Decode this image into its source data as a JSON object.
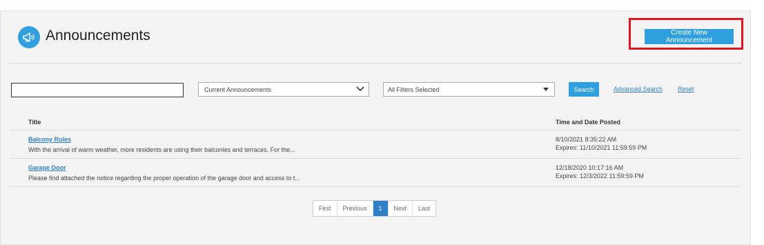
{
  "header": {
    "title": "Announcements",
    "icon": "megaphone-icon",
    "create_button": "Create New Announcement"
  },
  "search": {
    "keyword_value": "",
    "status_select": "Current Announcements",
    "filter_select": "All Filters Selected",
    "search_button": "Search",
    "advanced_search": "Advanced Search",
    "reset": "Reset"
  },
  "table": {
    "columns": [
      "Title",
      "Time and Date Posted"
    ],
    "rows": [
      {
        "title": "Balcony Rules",
        "description": "With the arrival of warm weather, more residents are using their balconies and terraces. For the...",
        "posted": "8/10/2021 8:35:22 AM",
        "expires": "Expires: 11/10/2021 11:59:59 PM"
      },
      {
        "title": "Garage Door",
        "description": "Please find attached the notice regarding the proper operation of the garage door and access to t...",
        "posted": "12/18/2020 10:17:16 AM",
        "expires": "Expires: 12/3/2022 11:59:59 PM"
      }
    ]
  },
  "pagination": {
    "first": "First",
    "previous": "Previous",
    "current": "1",
    "next": "Next",
    "last": "Last"
  },
  "colors": {
    "accent": "#2f9fe0",
    "link": "#2f7fc6",
    "highlight": "#e0141e"
  }
}
